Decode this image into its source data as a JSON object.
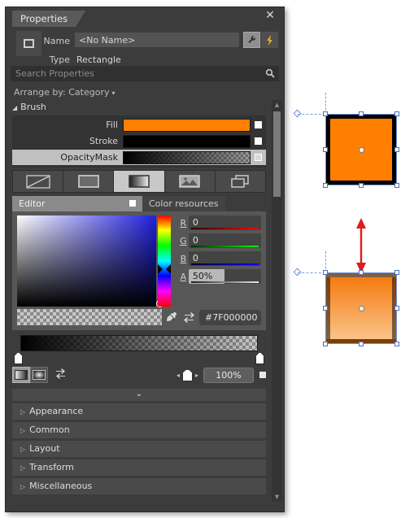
{
  "panel": {
    "tab_title": "Properties",
    "close_icon": "close-icon",
    "object": {
      "name_label": "Name",
      "name_value": "<No Name>",
      "type_label": "Type",
      "type_value": "Rectangle",
      "wrench_icon": "wrench-icon",
      "bolt_icon": "lightning-bolt-icon"
    },
    "search": {
      "placeholder": "Search Properties",
      "icon": "search-icon"
    },
    "arrange": {
      "label": "Arrange by: Category",
      "caret": "▾"
    },
    "brush_group": {
      "title": "Brush",
      "expanded_tri": "◢",
      "rows": [
        {
          "label": "Fill",
          "kind": "solid",
          "color": "#FF7F00",
          "selected": false,
          "marker": "solid"
        },
        {
          "label": "Stroke",
          "kind": "solid",
          "color": "#000000",
          "selected": false,
          "marker": "solid"
        },
        {
          "label": "OpacityMask",
          "kind": "gradient",
          "color": "#000000",
          "selected": true,
          "marker": "hollow"
        }
      ]
    },
    "brush_types": [
      {
        "name": "no-brush-button",
        "active": false
      },
      {
        "name": "solid-brush-button",
        "active": false
      },
      {
        "name": "gradient-brush-button",
        "active": true
      },
      {
        "name": "tile-brush-button",
        "active": false
      },
      {
        "name": "visual-brush-button",
        "active": false
      }
    ],
    "editor_tabs": {
      "editor": "Editor",
      "color_resources": "Color resources",
      "active": "Editor"
    },
    "color": {
      "channels": [
        {
          "label": "R",
          "value": "0"
        },
        {
          "label": "G",
          "value": "0"
        },
        {
          "label": "B",
          "value": "0"
        }
      ],
      "alpha": {
        "label": "A",
        "value": "50%",
        "percent": 50
      },
      "hex": "#7F000000",
      "eyedropper_icon": "eyedropper-icon",
      "swap_icon": "swap-colors-icon"
    },
    "gradient": {
      "stops": [
        {
          "name": "gradient-stop-start",
          "position": 0
        },
        {
          "name": "gradient-stop-end",
          "position": 100
        }
      ],
      "linear_icon": "linear-gradient-button",
      "radial_icon": "radial-gradient-button",
      "reverse_icon": "reverse-gradient-icon",
      "zoom_value": "100%",
      "spin_left": "◂",
      "spin_right": "▸"
    },
    "collapse_chevron": "⌄",
    "categories": [
      {
        "label": "Appearance",
        "tri": "▷"
      },
      {
        "label": "Common",
        "tri": "▷"
      },
      {
        "label": "Layout",
        "tri": "▷"
      },
      {
        "label": "Transform",
        "tri": "▷"
      },
      {
        "label": "Miscellaneous",
        "tri": "▷"
      }
    ],
    "scrollbar": {
      "up": "▲",
      "down": "▼"
    }
  },
  "canvas": {
    "shapes": [
      {
        "name": "rectangle-opaque-stroke",
        "fill": "#FF7F00",
        "stroke": "#000000",
        "stroke_alpha": "100%"
      },
      {
        "name": "rectangle-transparent-stroke",
        "fill_from": "#F57B10",
        "fill_to": "#FBC38A",
        "stroke": "#000000",
        "stroke_alpha": "50%"
      }
    ],
    "annotation_arrow": {
      "name": "comparison-arrow",
      "color": "#E01B1B"
    }
  }
}
